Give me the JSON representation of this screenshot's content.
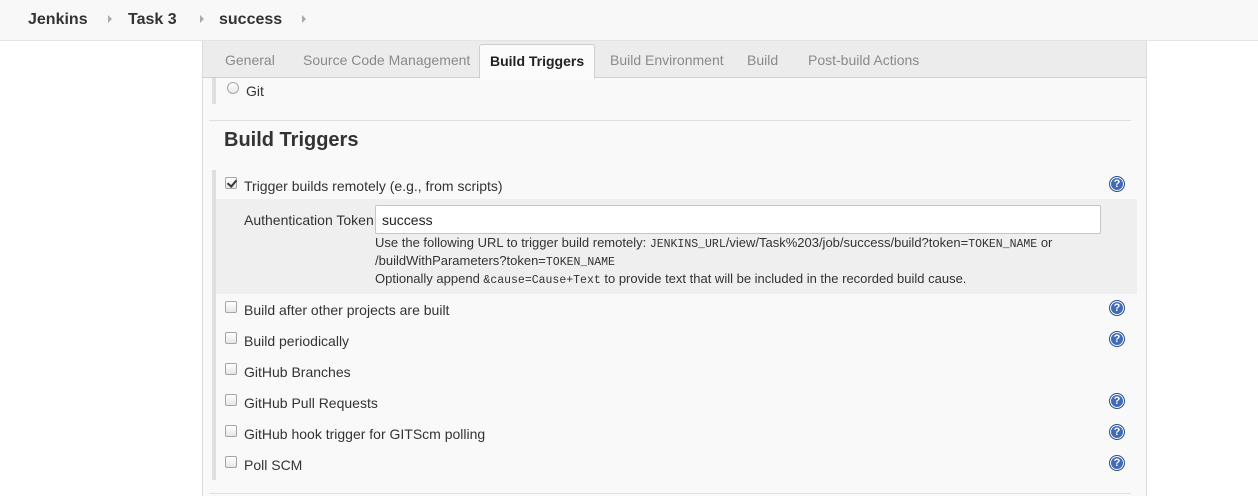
{
  "breadcrumb": {
    "items": [
      {
        "label": "Jenkins"
      },
      {
        "label": "Task 3"
      },
      {
        "label": "success"
      }
    ]
  },
  "tabs": [
    {
      "label": "General",
      "active": false
    },
    {
      "label": "Source Code Management",
      "active": false
    },
    {
      "label": "Build Triggers",
      "active": true
    },
    {
      "label": "Build Environment",
      "active": false
    },
    {
      "label": "Build",
      "active": false
    },
    {
      "label": "Post-build Actions",
      "active": false
    }
  ],
  "scm": {
    "git_label": "Git",
    "git_selected": false
  },
  "section": {
    "title": "Build Triggers"
  },
  "triggers": {
    "remote": {
      "label": "Trigger builds remotely (e.g., from scripts)",
      "checked": true,
      "token_label": "Authentication Token",
      "token_value": "success",
      "desc_prefix": "Use the following URL to trigger build remotely: ",
      "desc_url_var": "JENKINS_URL",
      "desc_url_path": "/view/Task%203/job/success/build?token=",
      "desc_token_var": "TOKEN_NAME",
      "desc_or": " or",
      "desc_line2_path": "/buildWithParameters?token=",
      "desc_line2_token_var": "TOKEN_NAME",
      "desc_line3_prefix": "Optionally append ",
      "desc_line3_code": "&cause=Cause+Text",
      "desc_line3_suffix": " to provide text that will be included in the recorded build cause."
    },
    "items": [
      {
        "label": "Build after other projects are built",
        "checked": false,
        "has_help": true
      },
      {
        "label": "Build periodically",
        "checked": false,
        "has_help": true
      },
      {
        "label": "GitHub Branches",
        "checked": false,
        "has_help": false
      },
      {
        "label": "GitHub Pull Requests",
        "checked": false,
        "has_help": true
      },
      {
        "label": "GitHub hook trigger for GITScm polling",
        "checked": false,
        "has_help": true
      },
      {
        "label": "Poll SCM",
        "checked": false,
        "has_help": true
      }
    ]
  },
  "help_glyph": "?",
  "colors": {
    "help_icon": "#3f6bb8",
    "active_tab_bg": "#fbfbfb",
    "panel_bg": "#f9f9f9"
  }
}
